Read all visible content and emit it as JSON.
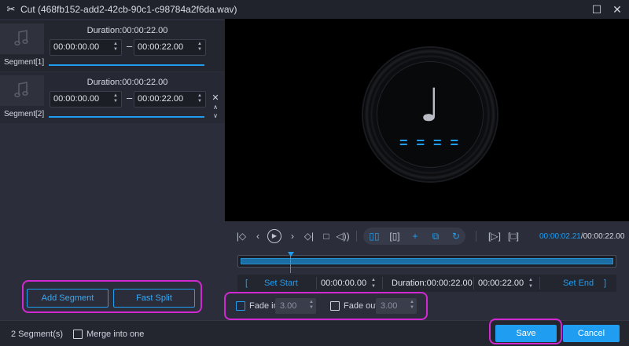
{
  "window": {
    "title": "Cut (468fb152-add2-42cb-90c1-c98784a2f6da.wav)",
    "icons": [
      "scissors-icon",
      "maximize-icon",
      "close-icon"
    ]
  },
  "segments": [
    {
      "label": "Segment[1]",
      "duration": "Duration:00:00:22.00",
      "start": "00:00:00.00",
      "end": "00:00:22.00"
    },
    {
      "label": "Segment[2]",
      "duration": "Duration:00:00:22.00",
      "start": "00:00:00.00",
      "end": "00:00:22.00"
    }
  ],
  "left_actions": {
    "add_segment": "Add Segment",
    "fast_split": "Fast Split"
  },
  "player": {
    "current_time": "00:00:02.21",
    "total_time": "/00:00:22.00",
    "playhead_fraction": 0.1
  },
  "cutbar": {
    "set_start": "Set Start",
    "start_value": "00:00:00.00",
    "duration": "Duration:00:00:22.00",
    "end_value": "00:00:22.00",
    "set_end": "Set End",
    "bracket_left": "[",
    "bracket_right": "]"
  },
  "fade": {
    "fade_in_label": "Fade in",
    "fade_in_value": "3.00",
    "fade_out_label": "Fade out",
    "fade_out_value": "3.00"
  },
  "bottom": {
    "segment_count": "2 Segment(s)",
    "merge_label": "Merge into one",
    "save": "Save",
    "cancel": "Cancel"
  },
  "colors": {
    "accent": "#1f9df0",
    "highlight": "#d228d2",
    "background": "#2b2e3a"
  }
}
